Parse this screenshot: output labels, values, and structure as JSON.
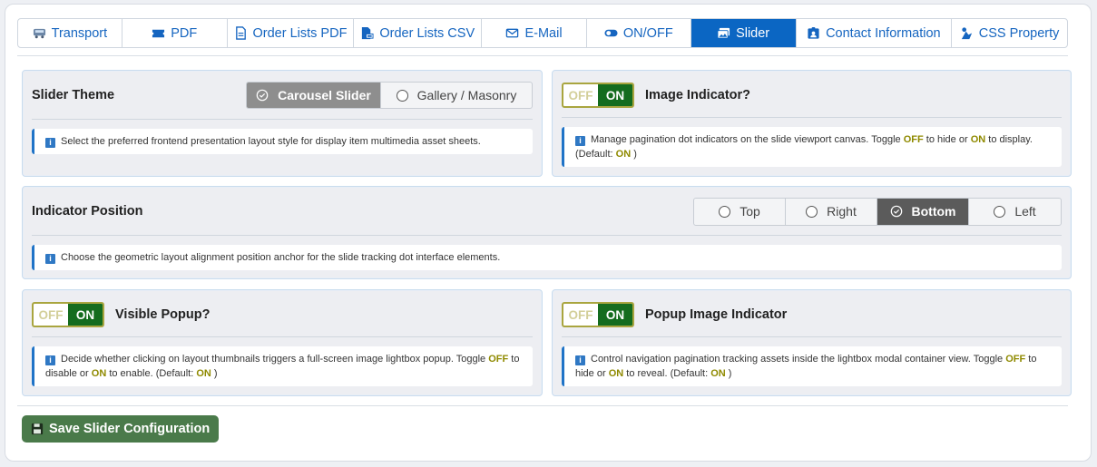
{
  "tabs": [
    {
      "label": "Transport",
      "icon": "truck-icon",
      "active": false
    },
    {
      "label": "PDF",
      "icon": "ticket-icon",
      "active": false
    },
    {
      "label": "Order Lists PDF",
      "icon": "document-icon",
      "active": false
    },
    {
      "label": "Order Lists CSV",
      "icon": "csv-file-icon",
      "active": false
    },
    {
      "label": "E-Mail",
      "icon": "envelope-icon",
      "active": false
    },
    {
      "label": "ON/OFF",
      "icon": "toggle-icon",
      "active": false
    },
    {
      "label": "Slider",
      "icon": "images-icon",
      "active": true
    },
    {
      "label": "Contact Information",
      "icon": "id-card-icon",
      "active": false
    },
    {
      "label": "CSS Property",
      "icon": "css-icon",
      "active": false
    }
  ],
  "slider_theme": {
    "label": "Slider Theme",
    "options": [
      "Carousel Slider",
      "Gallery / Masonry"
    ],
    "selected": "Carousel Slider",
    "info": "Select the preferred frontend presentation layout style for display item multimedia asset sheets."
  },
  "image_indicator": {
    "label": "Image Indicator?",
    "off": "OFF",
    "on": "ON",
    "info_pre": "Manage pagination dot indicators on the slide viewport canvas. Toggle",
    "info_off": "OFF",
    "info_mid": "to hide or",
    "info_on": "ON",
    "info_post": "to display.",
    "info_default_pre": "(Default:",
    "info_default_val": "ON",
    "info_default_post": ")"
  },
  "indicator_position": {
    "label": "Indicator Position",
    "options": [
      "Top",
      "Right",
      "Bottom",
      "Left"
    ],
    "selected": "Bottom",
    "info": "Choose the geometric layout alignment position anchor for the slide tracking dot interface elements."
  },
  "visible_popup": {
    "label": "Visible Popup?",
    "off": "OFF",
    "on": "ON",
    "info_pre": "Decide whether clicking on layout thumbnails triggers a full-screen image lightbox popup. Toggle",
    "info_off": "OFF",
    "info_mid": "to disable or",
    "info_on": "ON",
    "info_post": "to enable. (Default:",
    "info_default_val": "ON",
    "info_default_post": ")"
  },
  "popup_image_indicator": {
    "label": "Popup Image Indicator",
    "off": "OFF",
    "on": "ON",
    "info_pre": "Control navigation pagination tracking assets inside the lightbox modal container view. Toggle",
    "info_off": "OFF",
    "info_mid": "to hide or",
    "info_on": "ON",
    "info_post": "to reveal. (Default:",
    "info_default_val": "ON",
    "info_default_post": ")"
  },
  "save_button": "Save Slider Configuration",
  "colors": {
    "tab_text": "#1565c0",
    "tab_active_bg": "#0b66c3",
    "toggle_on_bg": "#146c1e",
    "highlight": "#8f8a00",
    "save_bg": "#4a7a4a"
  }
}
